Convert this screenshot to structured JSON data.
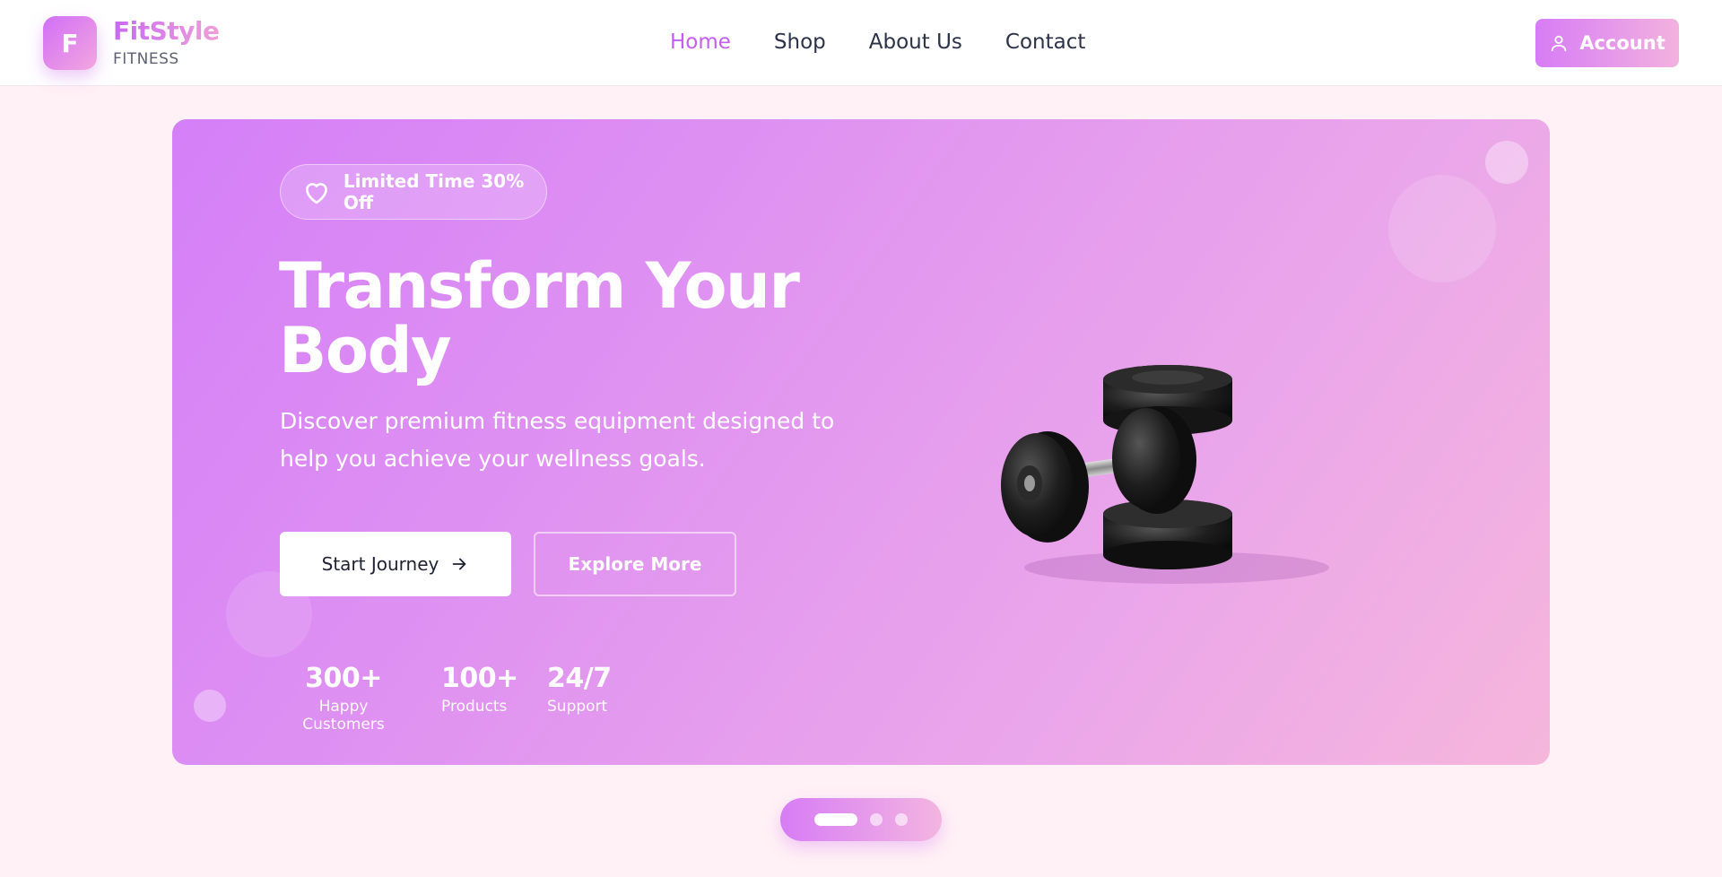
{
  "brand": {
    "logo_letter": "F",
    "name": "FitStyle",
    "tagline": "FITNESS"
  },
  "nav": {
    "items": [
      {
        "label": "Home",
        "active": true
      },
      {
        "label": "Shop",
        "active": false
      },
      {
        "label": "About Us",
        "active": false
      },
      {
        "label": "Contact",
        "active": false
      }
    ]
  },
  "header": {
    "account_label": "Account",
    "account_icon": "user-icon"
  },
  "hero": {
    "promo_label": "Limited Time 30% Off",
    "promo_icon": "heart-icon",
    "title_line1": "Transform Your",
    "title_line2": "Body",
    "description": "Discover premium fitness equipment designed to help you achieve your wellness goals.",
    "primary_button": "Start Journey",
    "secondary_button": "Explore More",
    "image": "dumbbells-image",
    "stats": [
      {
        "value": "300+",
        "label": "Happy Customers"
      },
      {
        "value": "100+",
        "label": "Products"
      },
      {
        "value": "24/7",
        "label": "Support"
      }
    ]
  },
  "carousel": {
    "slide_count": 3,
    "active_index": 0
  },
  "colors": {
    "accent": "#c35ef0",
    "gradient_start": "#d57ff8",
    "gradient_end": "#f5b6dc",
    "page_bg": "#fff1f5"
  }
}
